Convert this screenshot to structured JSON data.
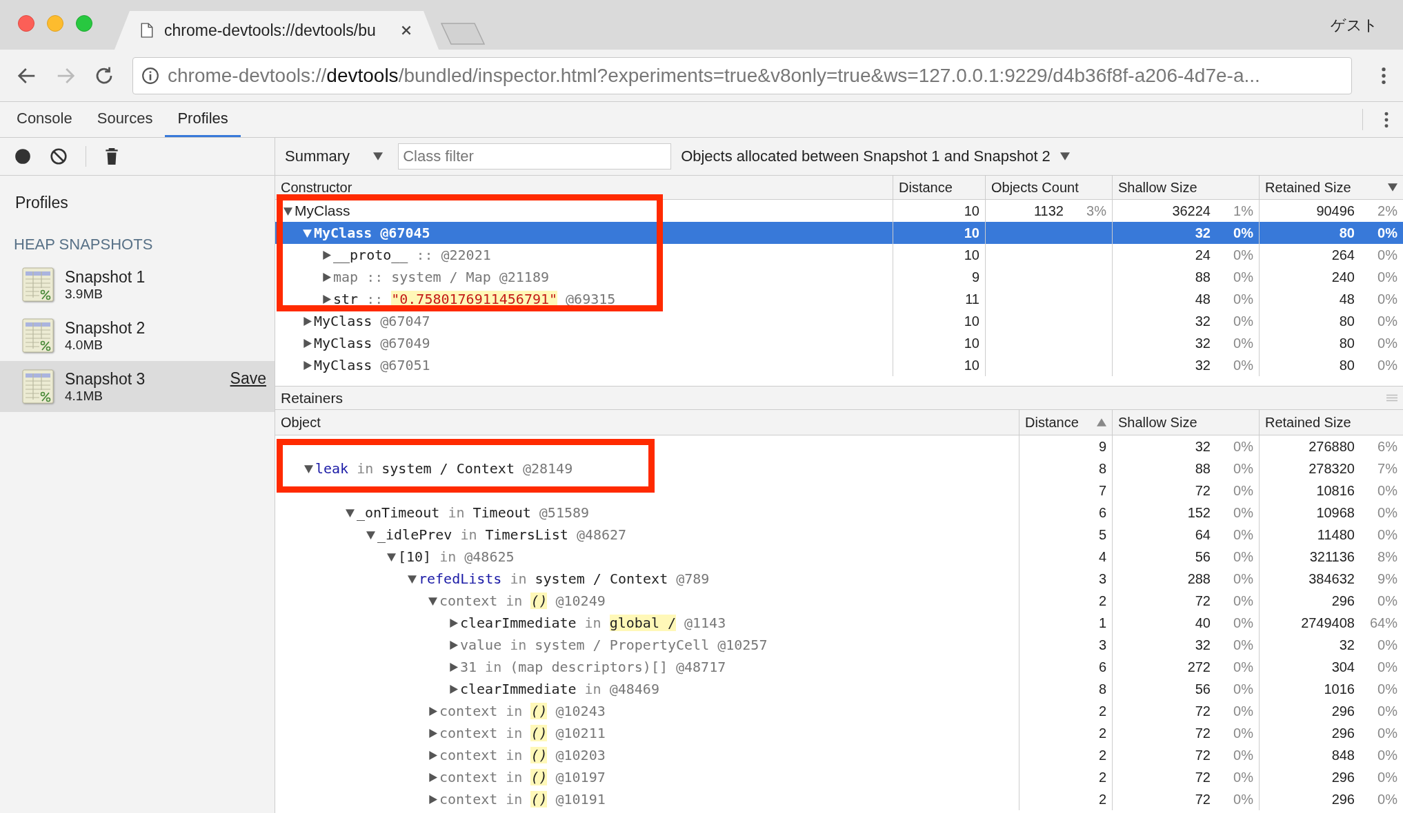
{
  "browser": {
    "tab_title": "chrome-devtools://devtools/bu",
    "profile_label": "ゲスト",
    "nav": [
      {
        "kind": "back",
        "disabled": false
      },
      {
        "kind": "forward",
        "disabled": true
      },
      {
        "kind": "reload",
        "disabled": false
      }
    ],
    "url": {
      "scheme": "chrome-devtools://",
      "host": "devtools",
      "path": "/bundled/inspector.html?experiments=true&v8only=true&ws=127.0.0.1:9229/d4b36f8f-a206-4d7e-a..."
    }
  },
  "devtools_tabs": [
    {
      "label": "Console",
      "selected": false
    },
    {
      "label": "Sources",
      "selected": false
    },
    {
      "label": "Profiles",
      "selected": true
    }
  ],
  "toolbar": {
    "view": "Summary",
    "class_filter_placeholder": "Class filter",
    "range": "Objects allocated between Snapshot 1 and Snapshot 2"
  },
  "sidebar": {
    "title": "Profiles",
    "section": "HEAP SNAPSHOTS",
    "snapshots": [
      {
        "name": "Snapshot 1",
        "size": "3.9MB",
        "selected": false
      },
      {
        "name": "Snapshot 2",
        "size": "4.0MB",
        "selected": false
      },
      {
        "name": "Snapshot 3",
        "size": "4.1MB",
        "selected": true,
        "action": "Save"
      }
    ]
  },
  "constructors": {
    "columns": [
      {
        "label": "Constructor",
        "sorted": false
      },
      {
        "label": "Distance",
        "sorted": false
      },
      {
        "label": "Objects Count",
        "sorted": false
      },
      {
        "label": "Shallow Size",
        "sorted": false
      },
      {
        "label": "Retained Size",
        "sorted": true,
        "ascending": false
      }
    ],
    "rows": [
      {
        "parts": [
          {
            "text": "MyClass",
            "kind": "class"
          }
        ],
        "expanded": true,
        "selected": false,
        "distance": "10",
        "count": "1132",
        "count_pct": "3%",
        "shallow": "36224",
        "shallow_pct": "1%",
        "retained": "90496",
        "retained_pct": "2%",
        "children": [
          {
            "parts": [
              {
                "text": "MyClass",
                "kind": "name"
              },
              {
                "text": "@67045",
                "kind": "id"
              }
            ],
            "expanded": true,
            "selected": true,
            "distance": "10",
            "shallow": "32",
            "shallow_pct": "0%",
            "retained": "80",
            "retained_pct": "0%",
            "children": [
              {
                "parts": [
                  {
                    "text": "__proto__",
                    "kind": "name"
                  },
                  {
                    "text": "::",
                    "kind": "kw"
                  },
                  {
                    "text": "@22021",
                    "kind": "id"
                  }
                ],
                "expanded": false,
                "selected": false,
                "distance": "10",
                "shallow": "24",
                "shallow_pct": "0%",
                "retained": "264",
                "retained_pct": "0%"
              },
              {
                "parts": [
                  {
                    "text": "map",
                    "kind": "weak"
                  },
                  {
                    "text": "::",
                    "kind": "kw"
                  },
                  {
                    "text": "system / Map",
                    "kind": "weak"
                  },
                  {
                    "text": "@21189",
                    "kind": "id"
                  }
                ],
                "expanded": false,
                "selected": false,
                "distance": "9",
                "shallow": "88",
                "shallow_pct": "0%",
                "retained": "240",
                "retained_pct": "0%"
              },
              {
                "parts": [
                  {
                    "text": "str",
                    "kind": "name"
                  },
                  {
                    "text": "::",
                    "kind": "kw"
                  },
                  {
                    "text": "\"0.7580176911456791\"",
                    "kind": "str"
                  },
                  {
                    "text": "@69315",
                    "kind": "id"
                  }
                ],
                "expanded": false,
                "selected": false,
                "distance": "11",
                "shallow": "48",
                "shallow_pct": "0%",
                "retained": "48",
                "retained_pct": "0%"
              }
            ]
          },
          {
            "parts": [
              {
                "text": "MyClass",
                "kind": "name"
              },
              {
                "text": "@67047",
                "kind": "id"
              }
            ],
            "expanded": false,
            "selected": false,
            "distance": "10",
            "shallow": "32",
            "shallow_pct": "0%",
            "retained": "80",
            "retained_pct": "0%"
          },
          {
            "parts": [
              {
                "text": "MyClass",
                "kind": "name"
              },
              {
                "text": "@67049",
                "kind": "id"
              }
            ],
            "expanded": false,
            "selected": false,
            "distance": "10",
            "shallow": "32",
            "shallow_pct": "0%",
            "retained": "80",
            "retained_pct": "0%"
          },
          {
            "parts": [
              {
                "text": "MyClass",
                "kind": "name"
              },
              {
                "text": "@67051",
                "kind": "id"
              }
            ],
            "expanded": false,
            "selected": false,
            "distance": "10",
            "shallow": "32",
            "shallow_pct": "0%",
            "retained": "80",
            "retained_pct": "0%"
          }
        ]
      }
    ]
  },
  "retainers": {
    "title": "Retainers",
    "columns": [
      {
        "label": "Object",
        "sorted": false
      },
      {
        "label": "Distance",
        "sorted": true,
        "ascending": true
      },
      {
        "label": "Shallow Size",
        "sorted": false
      },
      {
        "label": "Retained Size",
        "sorted": false
      }
    ],
    "rows": [
      {
        "distance": "9",
        "shallow": "32",
        "shallow_pct": "0%",
        "retained": "276880",
        "retained_pct": "6%",
        "children": [
          {
            "parts": [
              {
                "text": "leak",
                "kind": "var"
              },
              {
                "text": "in",
                "kind": "kw"
              },
              {
                "text": "system / Context",
                "kind": "name"
              },
              {
                "text": "@28149",
                "kind": "id"
              }
            ],
            "expanded": true,
            "distance": "8",
            "shallow": "88",
            "shallow_pct": "0%",
            "retained": "278320",
            "retained_pct": "7%",
            "children": [
              {
                "distance": "7",
                "shallow": "72",
                "shallow_pct": "0%",
                "retained": "10816",
                "retained_pct": "0%",
                "children": [
                  {
                    "parts": [
                      {
                        "text": "_onTimeout",
                        "kind": "name"
                      },
                      {
                        "text": "in",
                        "kind": "kw"
                      },
                      {
                        "text": "Timeout",
                        "kind": "name"
                      },
                      {
                        "text": "@51589",
                        "kind": "id"
                      }
                    ],
                    "expanded": true,
                    "distance": "6",
                    "shallow": "152",
                    "shallow_pct": "0%",
                    "retained": "10968",
                    "retained_pct": "0%",
                    "children": [
                      {
                        "parts": [
                          {
                            "text": "_idlePrev",
                            "kind": "name"
                          },
                          {
                            "text": "in",
                            "kind": "kw"
                          },
                          {
                            "text": "TimersList",
                            "kind": "name"
                          },
                          {
                            "text": "@48627",
                            "kind": "id"
                          }
                        ],
                        "expanded": true,
                        "distance": "5",
                        "shallow": "64",
                        "shallow_pct": "0%",
                        "retained": "11480",
                        "retained_pct": "0%",
                        "children": [
                          {
                            "parts": [
                              {
                                "text": "[10]",
                                "kind": "name"
                              },
                              {
                                "text": "in",
                                "kind": "kw"
                              },
                              {
                                "text": "@48625",
                                "kind": "id"
                              }
                            ],
                            "expanded": true,
                            "distance": "4",
                            "shallow": "56",
                            "shallow_pct": "0%",
                            "retained": "321136",
                            "retained_pct": "8%",
                            "children": [
                              {
                                "parts": [
                                  {
                                    "text": "refedLists",
                                    "kind": "var"
                                  },
                                  {
                                    "text": "in",
                                    "kind": "kw"
                                  },
                                  {
                                    "text": "system / Context",
                                    "kind": "name"
                                  },
                                  {
                                    "text": "@789",
                                    "kind": "id"
                                  }
                                ],
                                "expanded": true,
                                "distance": "3",
                                "shallow": "288",
                                "shallow_pct": "0%",
                                "retained": "384632",
                                "retained_pct": "9%",
                                "children": [
                                  {
                                    "parts": [
                                      {
                                        "text": "context",
                                        "kind": "weak"
                                      },
                                      {
                                        "text": "in",
                                        "kind": "kw"
                                      },
                                      {
                                        "text": "()",
                                        "kind": "hl"
                                      },
                                      {
                                        "text": "@10249",
                                        "kind": "id"
                                      }
                                    ],
                                    "expanded": true,
                                    "distance": "2",
                                    "shallow": "72",
                                    "shallow_pct": "0%",
                                    "retained": "296",
                                    "retained_pct": "0%",
                                    "children": [
                                      {
                                        "parts": [
                                          {
                                            "text": "clearImmediate",
                                            "kind": "name"
                                          },
                                          {
                                            "text": "in",
                                            "kind": "kw"
                                          },
                                          {
                                            "text": "global /",
                                            "kind": "hlname"
                                          },
                                          {
                                            "text": "@1143",
                                            "kind": "id"
                                          }
                                        ],
                                        "expanded": false,
                                        "distance": "1",
                                        "shallow": "40",
                                        "shallow_pct": "0%",
                                        "retained": "2749408",
                                        "retained_pct": "64%"
                                      },
                                      {
                                        "parts": [
                                          {
                                            "text": "value",
                                            "kind": "weak"
                                          },
                                          {
                                            "text": "in",
                                            "kind": "kw"
                                          },
                                          {
                                            "text": "system / PropertyCell",
                                            "kind": "weak"
                                          },
                                          {
                                            "text": "@10257",
                                            "kind": "id"
                                          }
                                        ],
                                        "expanded": false,
                                        "distance": "3",
                                        "shallow": "32",
                                        "shallow_pct": "0%",
                                        "retained": "32",
                                        "retained_pct": "0%"
                                      },
                                      {
                                        "parts": [
                                          {
                                            "text": "31",
                                            "kind": "weak"
                                          },
                                          {
                                            "text": "in",
                                            "kind": "kw"
                                          },
                                          {
                                            "text": "(map descriptors)[]",
                                            "kind": "weak"
                                          },
                                          {
                                            "text": "@48717",
                                            "kind": "id"
                                          }
                                        ],
                                        "expanded": false,
                                        "distance": "6",
                                        "shallow": "272",
                                        "shallow_pct": "0%",
                                        "retained": "304",
                                        "retained_pct": "0%"
                                      },
                                      {
                                        "parts": [
                                          {
                                            "text": "clearImmediate",
                                            "kind": "name"
                                          },
                                          {
                                            "text": "in",
                                            "kind": "kw"
                                          },
                                          {
                                            "text": "@48469",
                                            "kind": "id"
                                          }
                                        ],
                                        "expanded": false,
                                        "distance": "8",
                                        "shallow": "56",
                                        "shallow_pct": "0%",
                                        "retained": "1016",
                                        "retained_pct": "0%"
                                      }
                                    ]
                                  },
                                  {
                                    "parts": [
                                      {
                                        "text": "context",
                                        "kind": "weak"
                                      },
                                      {
                                        "text": "in",
                                        "kind": "kw"
                                      },
                                      {
                                        "text": "()",
                                        "kind": "hl"
                                      },
                                      {
                                        "text": "@10243",
                                        "kind": "id"
                                      }
                                    ],
                                    "expanded": false,
                                    "distance": "2",
                                    "shallow": "72",
                                    "shallow_pct": "0%",
                                    "retained": "296",
                                    "retained_pct": "0%"
                                  },
                                  {
                                    "parts": [
                                      {
                                        "text": "context",
                                        "kind": "weak"
                                      },
                                      {
                                        "text": "in",
                                        "kind": "kw"
                                      },
                                      {
                                        "text": "()",
                                        "kind": "hl"
                                      },
                                      {
                                        "text": "@10211",
                                        "kind": "id"
                                      }
                                    ],
                                    "expanded": false,
                                    "distance": "2",
                                    "shallow": "72",
                                    "shallow_pct": "0%",
                                    "retained": "296",
                                    "retained_pct": "0%"
                                  },
                                  {
                                    "parts": [
                                      {
                                        "text": "context",
                                        "kind": "weak"
                                      },
                                      {
                                        "text": "in",
                                        "kind": "kw"
                                      },
                                      {
                                        "text": "()",
                                        "kind": "hl"
                                      },
                                      {
                                        "text": "@10203",
                                        "kind": "id"
                                      }
                                    ],
                                    "expanded": false,
                                    "distance": "2",
                                    "shallow": "72",
                                    "shallow_pct": "0%",
                                    "retained": "848",
                                    "retained_pct": "0%"
                                  },
                                  {
                                    "parts": [
                                      {
                                        "text": "context",
                                        "kind": "weak"
                                      },
                                      {
                                        "text": "in",
                                        "kind": "kw"
                                      },
                                      {
                                        "text": "()",
                                        "kind": "hl"
                                      },
                                      {
                                        "text": "@10197",
                                        "kind": "id"
                                      }
                                    ],
                                    "expanded": false,
                                    "distance": "2",
                                    "shallow": "72",
                                    "shallow_pct": "0%",
                                    "retained": "296",
                                    "retained_pct": "0%"
                                  },
                                  {
                                    "parts": [
                                      {
                                        "text": "context",
                                        "kind": "weak"
                                      },
                                      {
                                        "text": "in",
                                        "kind": "kw"
                                      },
                                      {
                                        "text": "()",
                                        "kind": "hl"
                                      },
                                      {
                                        "text": "@10191",
                                        "kind": "id"
                                      }
                                    ],
                                    "expanded": false,
                                    "distance": "2",
                                    "shallow": "72",
                                    "shallow_pct": "0%",
                                    "retained": "296",
                                    "retained_pct": "0%"
                                  }
                                ]
                              }
                            ]
                          }
                        ]
                      }
                    ]
                  }
                ]
              }
            ]
          }
        ]
      }
    ]
  }
}
